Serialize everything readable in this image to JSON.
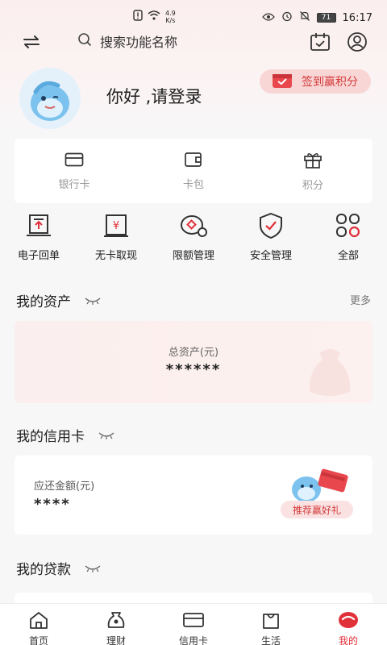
{
  "status_bar": {
    "speed_value": "4.9",
    "speed_unit": "K/s",
    "battery": "71",
    "time": "16:17"
  },
  "header": {
    "search_placeholder": "搜索功能名称"
  },
  "profile": {
    "greeting": "你好 ,请登录",
    "signin_label": "签到赢积分"
  },
  "quick_card": {
    "items": [
      {
        "label": "银行卡",
        "icon": "bank-card-icon"
      },
      {
        "label": "卡包",
        "icon": "card-wallet-icon"
      },
      {
        "label": "积分",
        "icon": "gift-icon"
      }
    ]
  },
  "functions": {
    "items": [
      {
        "label": "电子回单",
        "icon": "e-receipt-icon"
      },
      {
        "label": "无卡取现",
        "icon": "cardless-cash-icon"
      },
      {
        "label": "限额管理",
        "icon": "limit-management-icon"
      },
      {
        "label": "安全管理",
        "icon": "security-shield-icon"
      },
      {
        "label": "全部",
        "icon": "all-functions-icon"
      }
    ]
  },
  "assets": {
    "title": "我的资产",
    "more": "更多",
    "total_label": "总资产(元)",
    "total_value": "******"
  },
  "credit": {
    "title": "我的信用卡",
    "due_label": "应还金额(元)",
    "due_value": "****",
    "recommend_label": "推荐赢好礼"
  },
  "loan": {
    "title": "我的贷款"
  },
  "nav": {
    "items": [
      {
        "label": "首页",
        "icon": "home-icon"
      },
      {
        "label": "理财",
        "icon": "wealth-icon"
      },
      {
        "label": "信用卡",
        "icon": "credit-card-icon"
      },
      {
        "label": "生活",
        "icon": "shopping-bag-icon"
      },
      {
        "label": "我的",
        "icon": "profile-smile-icon"
      }
    ],
    "active": "我的"
  },
  "colors": {
    "accent": "#e0303a",
    "signin_bg": "#f8d6d6",
    "background": "#f7f7f8"
  }
}
